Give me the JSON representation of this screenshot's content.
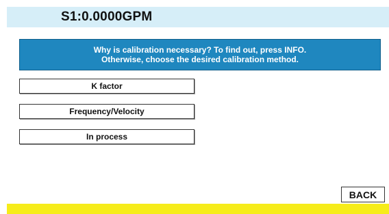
{
  "header": {
    "title": "S1:0.0000GPM"
  },
  "info_banner": {
    "line1": "Why is calibration necessary? To find out, press INFO.",
    "line2": "Otherwise, choose the desired calibration method."
  },
  "menu": {
    "items": [
      {
        "label": "K factor"
      },
      {
        "label": "Frequency/Velocity"
      },
      {
        "label": "In process"
      }
    ]
  },
  "footer": {
    "back_label": "BACK"
  },
  "colors": {
    "header_bg": "#d6eef8",
    "banner_bg": "#1f87bf",
    "footer_bar": "#f6ec1a"
  }
}
